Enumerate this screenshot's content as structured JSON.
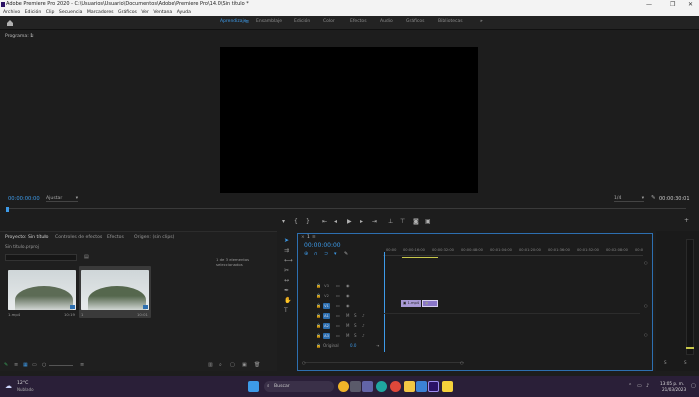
{
  "window": {
    "title": "Adobe Premiere Pro 2020 - C:\\Usuarios\\Usuario\\Documentos\\Adobe\\Premiere Pro\\14.0\\Sin título *",
    "controls": [
      "—",
      "❐",
      "✕"
    ]
  },
  "menu": [
    "Archivo",
    "Edición",
    "Clip",
    "Secuencia",
    "Marcadores",
    "Gráficos",
    "Ver",
    "Ventana",
    "Ayuda"
  ],
  "workspaces": {
    "items": [
      "Aprendizaje",
      "Ensamblaje",
      "Edición",
      "Color",
      "Efectos",
      "Audio",
      "Gráficos",
      "Bibliotecas"
    ],
    "active": "Aprendizaje",
    "more": "»"
  },
  "program_monitor": {
    "label": "Programa: 1",
    "timecode_left": "00:00:00:00",
    "fit": "Ajustar",
    "quality": "1/4",
    "timecode_right": "00:00:30:01"
  },
  "project_panel": {
    "tabs": [
      "Proyecto: Sin título",
      "Controles de efectos",
      "Efectos",
      "Origen: (sin clips)"
    ],
    "subtitle": "Sin título.prproj",
    "selection_info": "1 de 3 elementos seleccionados",
    "clips": [
      {
        "name": "1.mp4",
        "duration": "10:19"
      },
      {
        "name": "1",
        "duration": "10:01"
      }
    ]
  },
  "timeline": {
    "tab": "1",
    "timecode": "00:00:00:00",
    "ruler": [
      "00:00",
      "00:00:16:00",
      "00:00:32:00",
      "00:00:48:00",
      "00:01:04:00",
      "00:01:20:00",
      "00:01:36:00",
      "00:01:52:00",
      "00:02:08:00",
      "00:0"
    ],
    "video_tracks": [
      "V3",
      "V2",
      "V1"
    ],
    "audio_tracks": [
      "A1",
      "A2",
      "A3"
    ],
    "master": "Original",
    "master_value": "0.0",
    "clip_label": "1.mp4"
  },
  "taskbar": {
    "weather_temp": "12°C",
    "weather_desc": "Nublado",
    "search": "Buscar",
    "time": "13:05 p. m.",
    "date": "21/03/2023"
  },
  "colors": {
    "accent": "#3d9ae8",
    "clip_video": "#a99ad6",
    "clip_audio": "#8a76c9",
    "track_target": "#2d6fb0"
  }
}
